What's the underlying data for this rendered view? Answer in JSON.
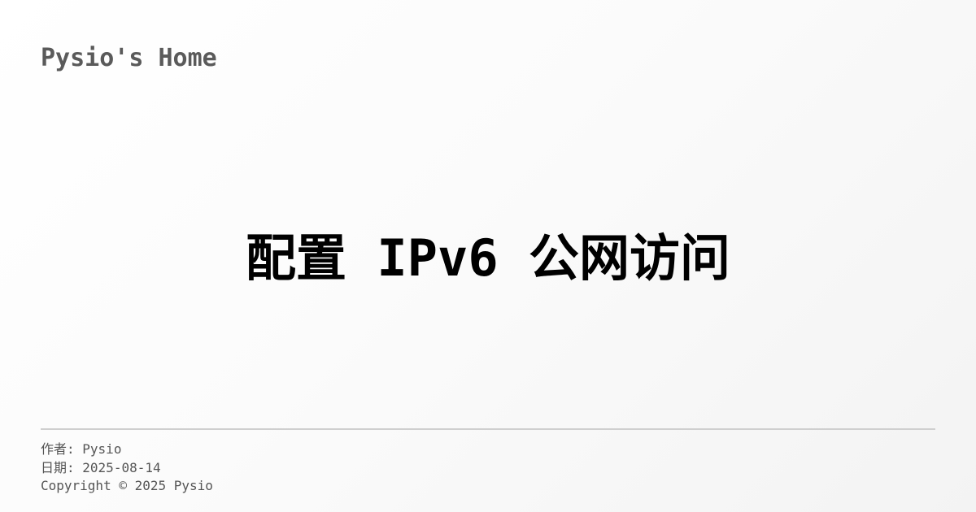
{
  "header": {
    "site_title": "Pysio's Home"
  },
  "post": {
    "title": "配置 IPv6 公网访问"
  },
  "footer": {
    "author_label": "作者:",
    "author": "Pysio",
    "date_label": "日期:",
    "date": "2025-08-14",
    "copyright": "Copyright © 2025 Pysio"
  }
}
